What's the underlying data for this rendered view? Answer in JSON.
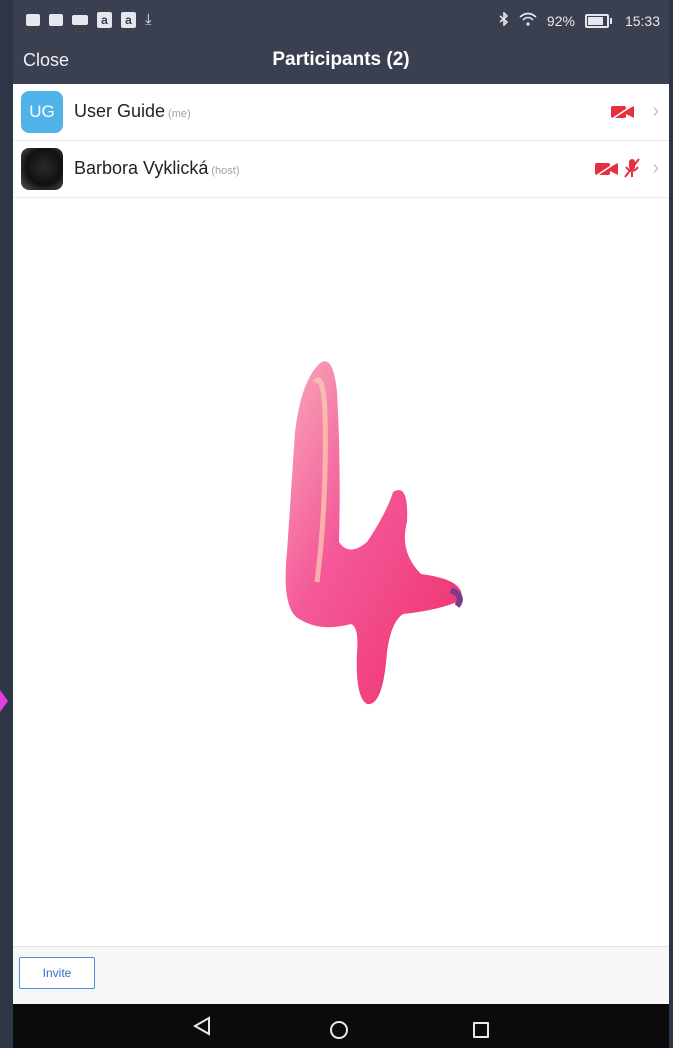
{
  "status_bar": {
    "battery": "92%",
    "time": "15:33"
  },
  "header": {
    "close_label": "Close",
    "title": "Participants (2)"
  },
  "participants": [
    {
      "name": "User Guide",
      "tag": "(me)",
      "avatar_initials": "UG",
      "video_muted": true,
      "audio_muted": false
    },
    {
      "name": "Barbora Vyklická",
      "tag": "(host)",
      "avatar_initials": "",
      "video_muted": true,
      "audio_muted": true
    }
  ],
  "footer": {
    "invite_label": "Invite"
  },
  "colors": {
    "accent": "#2c6fd1",
    "muted_red": "#e5303f",
    "avatar_blue": "#4fb3ea",
    "header_bg": "#3b4050"
  },
  "icons": [
    "bluetooth-icon",
    "wifi-icon",
    "battery-icon",
    "video-muted-icon",
    "mic-muted-icon",
    "chevron-right-icon",
    "back-icon",
    "home-icon",
    "recents-icon"
  ]
}
